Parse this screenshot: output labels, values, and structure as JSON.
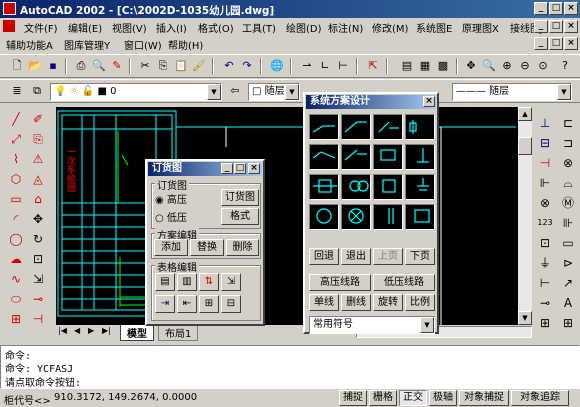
{
  "window": {
    "title": "AutoCAD 2002 - [C:\\2002D-1035幼儿园.dwg]",
    "min": "_",
    "max": "□",
    "close": "×"
  },
  "menu1": [
    "文件(F)",
    "编辑(E)",
    "视图(V)",
    "插入(I)",
    "格式(O)",
    "工具(T)",
    "绘图(D)",
    "标注(N)",
    "修改(M)",
    "系统图E",
    "原理图X",
    "接线图J"
  ],
  "menu2": [
    "辅助功能A",
    "图库管理Y",
    "窗口(W)",
    "帮助(H)"
  ],
  "props": {
    "layer": "0",
    "color": "随层",
    "linetype": "——— 随层"
  },
  "drawing": {
    "title_block_text": "一次系统图",
    "tab_model": "模型",
    "tab_layout": "布局1"
  },
  "order_dialog": {
    "title": "订货图",
    "group1": "订货图",
    "radio_high": "高压",
    "radio_low": "低压",
    "btn_order": "订货图",
    "btn_format": "格式",
    "group2": "方案编辑",
    "btn_add": "添加",
    "btn_replace": "替换",
    "btn_delete": "删除",
    "group3": "表格编辑"
  },
  "scheme_dialog": {
    "title": "系统方案设计",
    "btn_back": "回退",
    "btn_exit": "退出",
    "btn_prev": "上页",
    "btn_next": "下页",
    "btn_hv_line": "高压线路",
    "btn_lv_line": "低压线路",
    "btn_single": "单线",
    "btn_delete_line": "删线",
    "btn_rotate": "旋转",
    "btn_scale": "比例",
    "symbol_select": "常用符号"
  },
  "command": {
    "line1": "命令:",
    "line2": "命令:  YCFASJ",
    "line3": "请点取命令按钮:"
  },
  "status": {
    "coords": "910.3172,  149.2674,  0.0000",
    "prefix": "柜代号<>",
    "buttons": [
      "捕捉",
      "栅格",
      "正交",
      "极轴",
      "对象捕捉",
      "对象追踪"
    ]
  },
  "icons": {
    "app": "autocad-logo-icon",
    "new": "new-file-icon",
    "open": "open-folder-icon",
    "save": "save-icon",
    "print": "print-icon",
    "preview": "print-preview-icon",
    "cut": "cut-icon",
    "copy": "copy-icon",
    "paste": "paste-icon",
    "undo": "undo-icon",
    "redo": "redo-icon",
    "pan": "pan-icon",
    "zoom": "zoom-icon"
  }
}
